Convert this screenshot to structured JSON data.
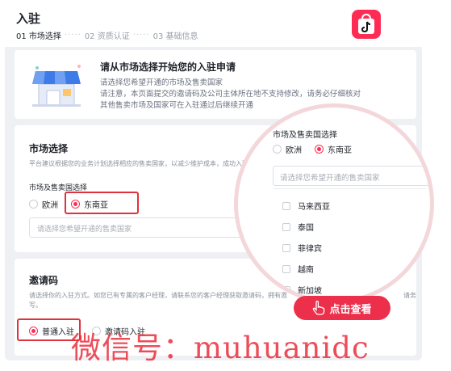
{
  "header": {
    "title": "入驻",
    "steps": [
      "01 市场选择",
      "02 资质认证",
      "03 基础信息"
    ]
  },
  "app_icon": {
    "name": "tiktok-shop-icon",
    "color": "#fe2c55"
  },
  "banner": {
    "title": "请从市场选择开始您的入驻申请",
    "lines": [
      "请选择您希望开通的市场及售卖国家",
      "请注意，本页面提交的邀请码及公司主体所在地不支持修改，请务必仔细核对",
      "其他售卖市场及国家可在入驻通过后继续开通"
    ]
  },
  "market": {
    "title": "市场选择",
    "desc": "平台建议根据您的业务计划选择相应的售卖国家，以减少维护成本，成功入驻",
    "field_label": "市场及售卖国选择",
    "options": [
      "欧洲",
      "东南亚"
    ],
    "selected": "东南亚",
    "placeholder": "请选择您希望开通的售卖国家"
  },
  "invite": {
    "title": "邀请码",
    "desc": "请选择你的入驻方式。如您已有专属的客户经理，请联系您的客户经理获取邀请码，拥有邀",
    "desc_tail": "请务",
    "desc_line2": "写。",
    "options": [
      "普通入驻",
      "邀请码入驻"
    ],
    "selected": "普通入驻"
  },
  "magnifier": {
    "field_label": "市场及售卖国选择",
    "options": [
      "欧洲",
      "东南亚"
    ],
    "selected": "东南亚",
    "placeholder": "请选择您希望开通的售卖国家",
    "countries": [
      "马来西亚",
      "泰国",
      "菲律宾",
      "越南",
      "新加坡"
    ]
  },
  "cta": {
    "label": "点击查看",
    "icon": "hand-pointer-icon"
  },
  "watermark": "微信号：muhuanidc",
  "colors": {
    "accent": "#fe2c55",
    "highlight": "#e0323c",
    "cta": "#ec2f4b"
  }
}
